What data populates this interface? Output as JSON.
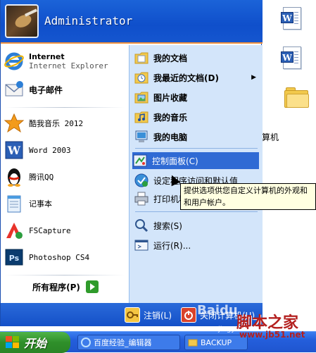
{
  "desktop": {
    "fragment_text": "算机"
  },
  "start_menu": {
    "username": "Administrator",
    "pinned": [
      {
        "title": "Internet",
        "subtitle": "Internet Explorer"
      },
      {
        "title": "电子邮件"
      }
    ],
    "recent": [
      {
        "label": "酷我音乐 2012"
      },
      {
        "label": "Word 2003"
      },
      {
        "label": "腾讯QQ"
      },
      {
        "label": "记事本"
      },
      {
        "label": "FSCapture"
      },
      {
        "label": "Photoshop CS4"
      }
    ],
    "all_programs": "所有程序(P)",
    "right": [
      {
        "label": "我的文档"
      },
      {
        "label": "我最近的文档(D)"
      },
      {
        "label": "图片收藏"
      },
      {
        "label": "我的音乐"
      },
      {
        "label": "我的电脑"
      },
      {
        "label": "控制面板(C)"
      },
      {
        "label": "设定程序访问和默认值"
      },
      {
        "label": "打印机和传真"
      },
      {
        "label": "搜索(S)"
      },
      {
        "label": "运行(R)..."
      }
    ],
    "footer": {
      "logoff": "注销(L)",
      "shutdown": "关闭计算机(U)"
    }
  },
  "tooltip": {
    "line1": "提供选项供您自定义计算机的外观和",
    "line2": "和用户帐户。"
  },
  "taskbar": {
    "start": "开始",
    "tasks": [
      {
        "label": "百度经验_编辑器"
      },
      {
        "label": "BACKUP"
      }
    ]
  },
  "watermark": {
    "brand": "脚本之家",
    "url": "www.jb51.net",
    "baidu": "Baidu",
    "baidu_sub": "jingyan"
  }
}
